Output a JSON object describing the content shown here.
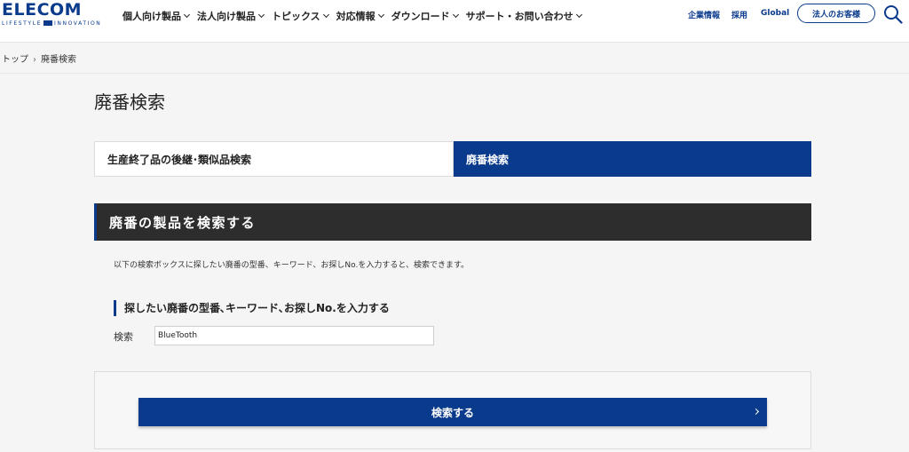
{
  "brand": {
    "logo_text": "ELECOM",
    "tagline_left": "LIFESTYLE",
    "tagline_right": "INNOVATION",
    "primary_color": "#0a3a8c"
  },
  "nav": {
    "items": [
      {
        "label": "個人向け製品",
        "icon": "chevron-down-icon"
      },
      {
        "label": "法人向け製品",
        "icon": "chevron-down-icon"
      },
      {
        "label": "トピックス",
        "icon": "chevron-down-icon"
      },
      {
        "label": "対応情報",
        "icon": "chevron-down-icon"
      },
      {
        "label": "ダウンロード",
        "icon": "chevron-down-icon"
      },
      {
        "label": "サポート・お問い合わせ",
        "icon": "chevron-down-icon"
      }
    ],
    "util_links": [
      "企業情報",
      "採用",
      "Global"
    ],
    "corporate_button": "法人のお客様",
    "search_icon": "search-icon"
  },
  "breadcrumb": {
    "items": [
      "トップ",
      "廃番検索"
    ],
    "separator": "›"
  },
  "page": {
    "title": "廃番検索"
  },
  "tabs": [
    {
      "label": "生産終了品の後継･類似品検索",
      "active": false
    },
    {
      "label": "廃番検索",
      "active": true
    }
  ],
  "section": {
    "heading": "廃番の製品を検索する",
    "description": "以下の検索ボックスに探したい廃番の型番、キーワード、お探しNo.を入力すると、検索できます。",
    "subheading": "探したい廃番の型番､キーワード､お探しNo.を入力する",
    "field_label": "検索",
    "search_value": "BlueTooth",
    "submit_label": "検索する"
  }
}
